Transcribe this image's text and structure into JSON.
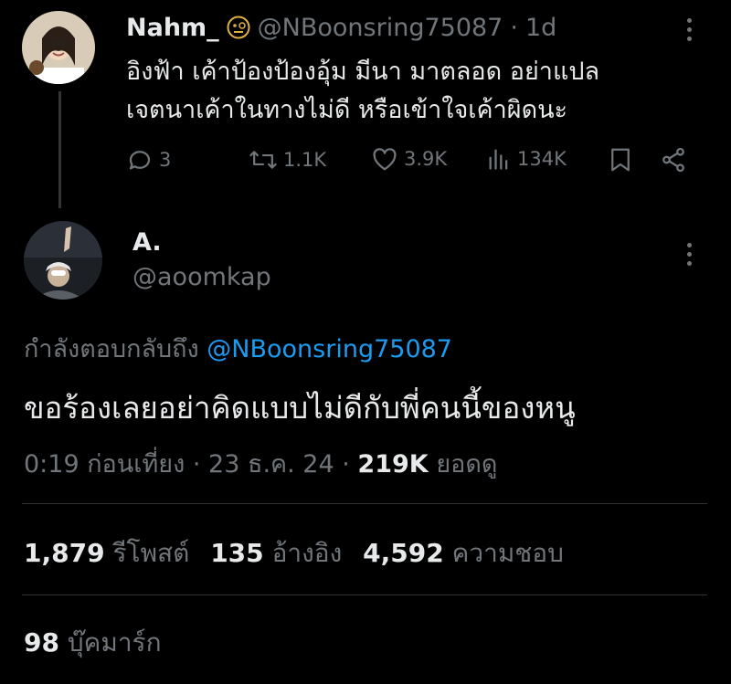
{
  "parent_tweet": {
    "display_name": "Nahm_",
    "handle": "@NBoonsring75087",
    "time": "1d",
    "emoji_badge": "monocle-face-icon",
    "text_line1": "อิงฟ้า เค้าป้องป้องอุ้ม มีนา มาตลอด อย่าแปล",
    "text_line2": "เจตนาเค้าในทางไม่ดี หรือเข้าใจเค้าผิดนะ",
    "replies": "3",
    "reposts": "1.1K",
    "likes": "3.9K",
    "views": "134K"
  },
  "main_tweet": {
    "display_name": "A.",
    "handle": "@aoomkap",
    "replying_to_label": "กำลังตอบกลับถึง",
    "replying_to_handle": "@NBoonsring75087",
    "text": "ขอร้องเลยอย่าคิดแบบไม่ดีกับพี่คนนี้ของหนู",
    "time": "0:19 ก่อนเที่ยง",
    "date": "23 ธ.ค. 24",
    "views_count": "219K",
    "views_label": "ยอดดู",
    "sep": "·"
  },
  "stats": {
    "reposts_count": "1,879",
    "reposts_label": "รีโพสต์",
    "quotes_count": "135",
    "quotes_label": "อ้างอิง",
    "likes_count": "4,592",
    "likes_label": "ความชอบ",
    "bookmarks_count": "98",
    "bookmarks_label": "บุ๊คมาร์ก"
  },
  "colors": {
    "background": "#000000",
    "text": "#e7e9ea",
    "muted": "#71767b",
    "link": "#1d9bf0",
    "divider": "#2f3336"
  }
}
